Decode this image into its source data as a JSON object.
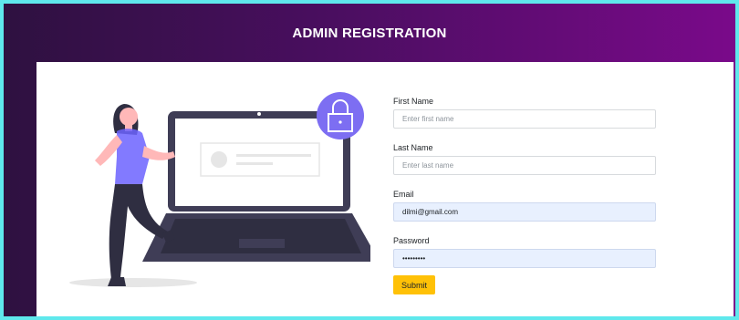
{
  "header": {
    "title": "ADMIN REGISTRATION"
  },
  "colors": {
    "accent": "#7d6ef2",
    "submit": "#ffc107",
    "background_start": "#2e1140",
    "background_end": "#7a0a8a",
    "outer_border": "#5fe8ec"
  },
  "illustration": {
    "icons": [
      "person-icon",
      "laptop-icon",
      "lock-icon"
    ]
  },
  "form": {
    "fields": [
      {
        "label": "First Name",
        "placeholder": "Enter first name",
        "value": ""
      },
      {
        "label": "Last Name",
        "placeholder": "Enter last name",
        "value": ""
      },
      {
        "label": "Email",
        "placeholder": "",
        "value": "dilmi@gmail.com"
      },
      {
        "label": "Password",
        "placeholder": "",
        "value": "dilmi1234"
      }
    ],
    "submit_label": "Submit"
  }
}
